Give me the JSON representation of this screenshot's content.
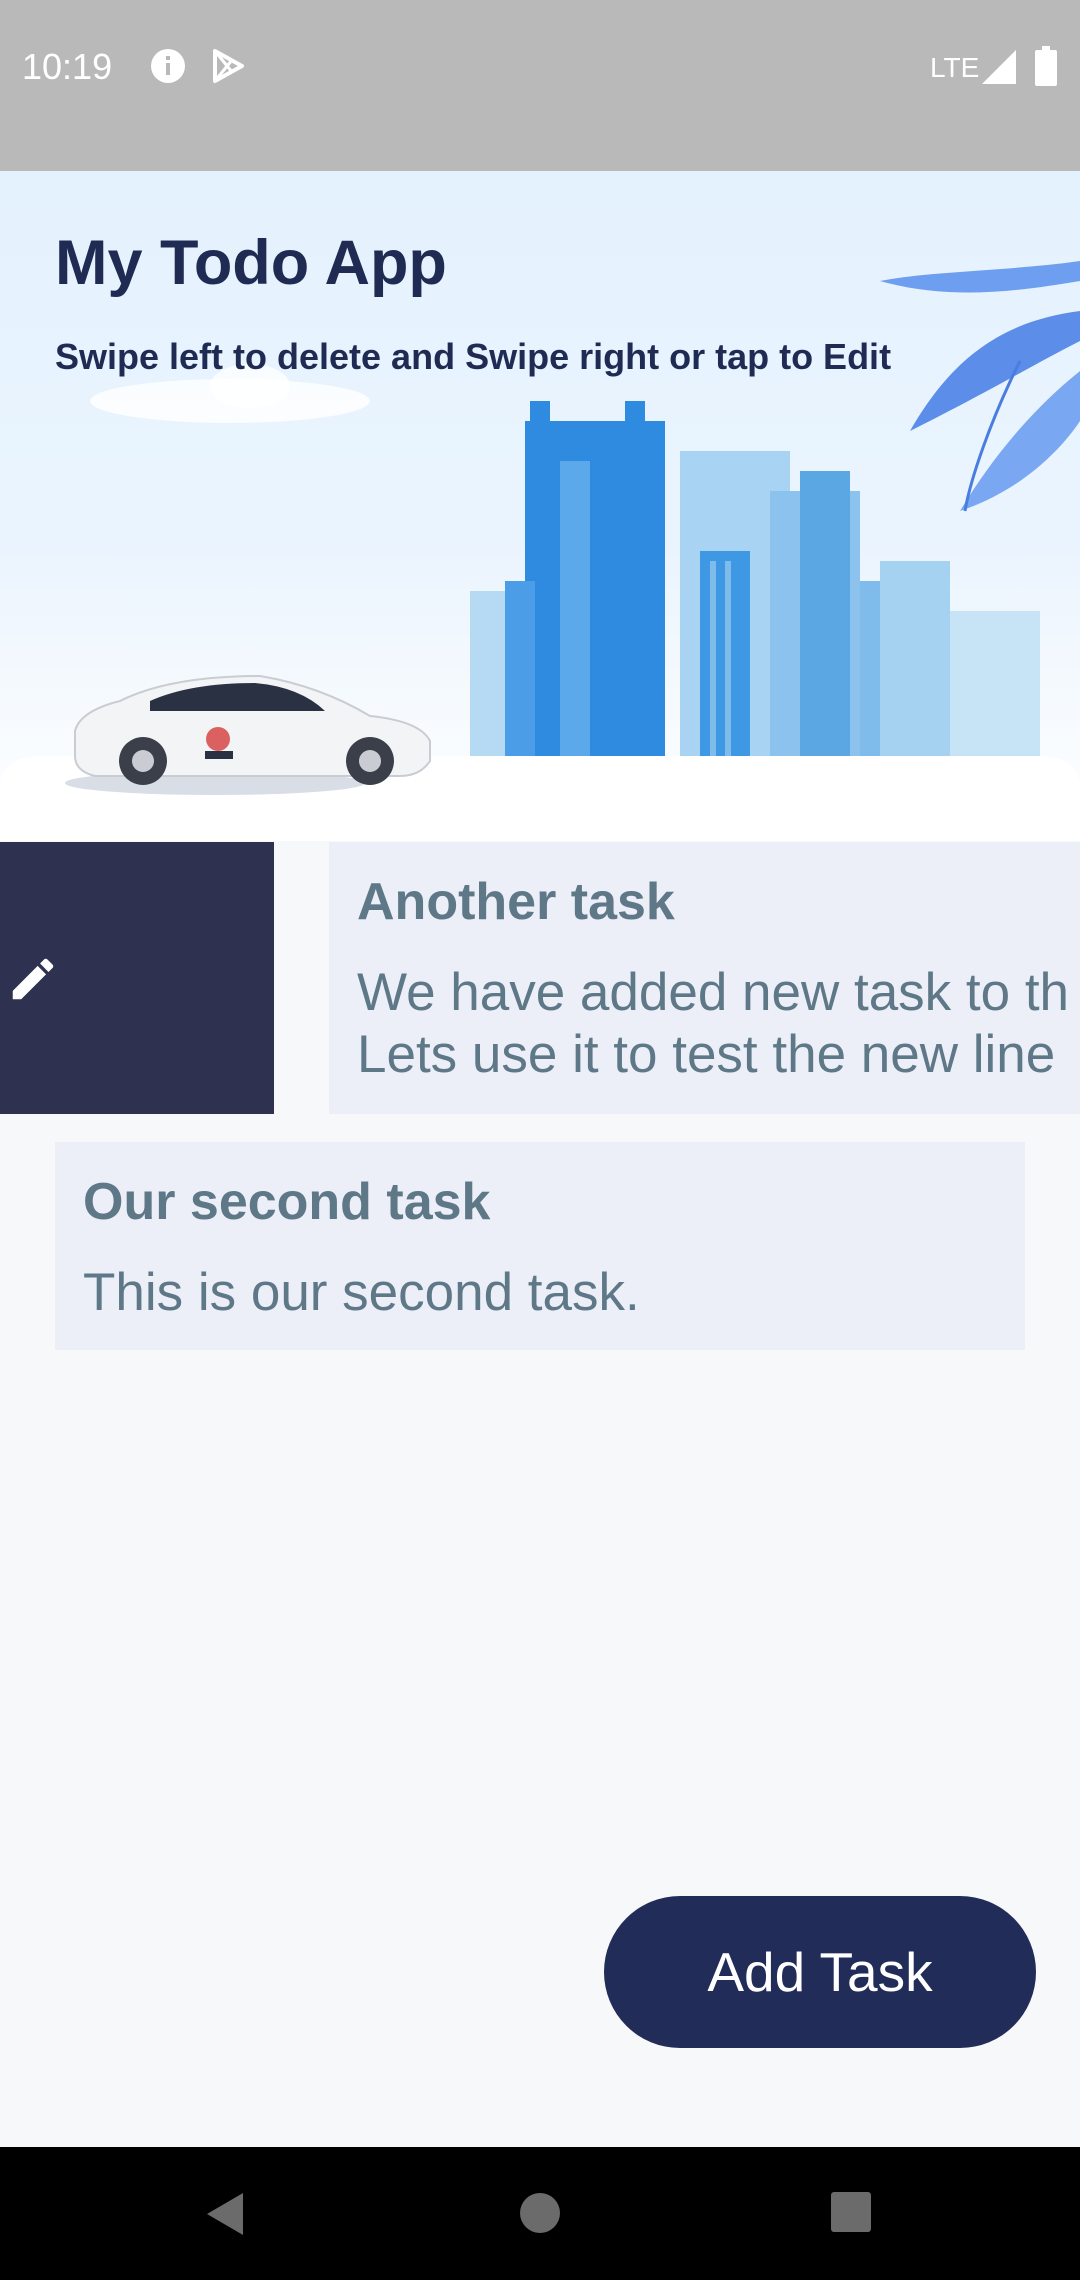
{
  "status_bar": {
    "time": "10:19",
    "network": "LTE",
    "icons": [
      "info-icon",
      "play-store-icon",
      "signal-icon",
      "battery-icon"
    ]
  },
  "header": {
    "title": "My Todo App",
    "subtitle": "Swipe left to delete and Swipe right or tap to Edit"
  },
  "tasks": [
    {
      "title": "Another task",
      "description": "We have added new task to th\nLets use it to test the new line",
      "swipe_action_icon": "edit-icon"
    },
    {
      "title": "Our second task",
      "description": "This is our second task."
    }
  ],
  "fab": {
    "label": "Add Task"
  },
  "nav": {
    "icons": [
      "back-icon",
      "home-icon",
      "recents-icon"
    ]
  },
  "colors": {
    "header_text": "#1f2b53",
    "task_card": "#eceef8",
    "task_text": "#5e7887",
    "edit_action_bg": "#2e3150",
    "button_bg": "#222c59"
  }
}
